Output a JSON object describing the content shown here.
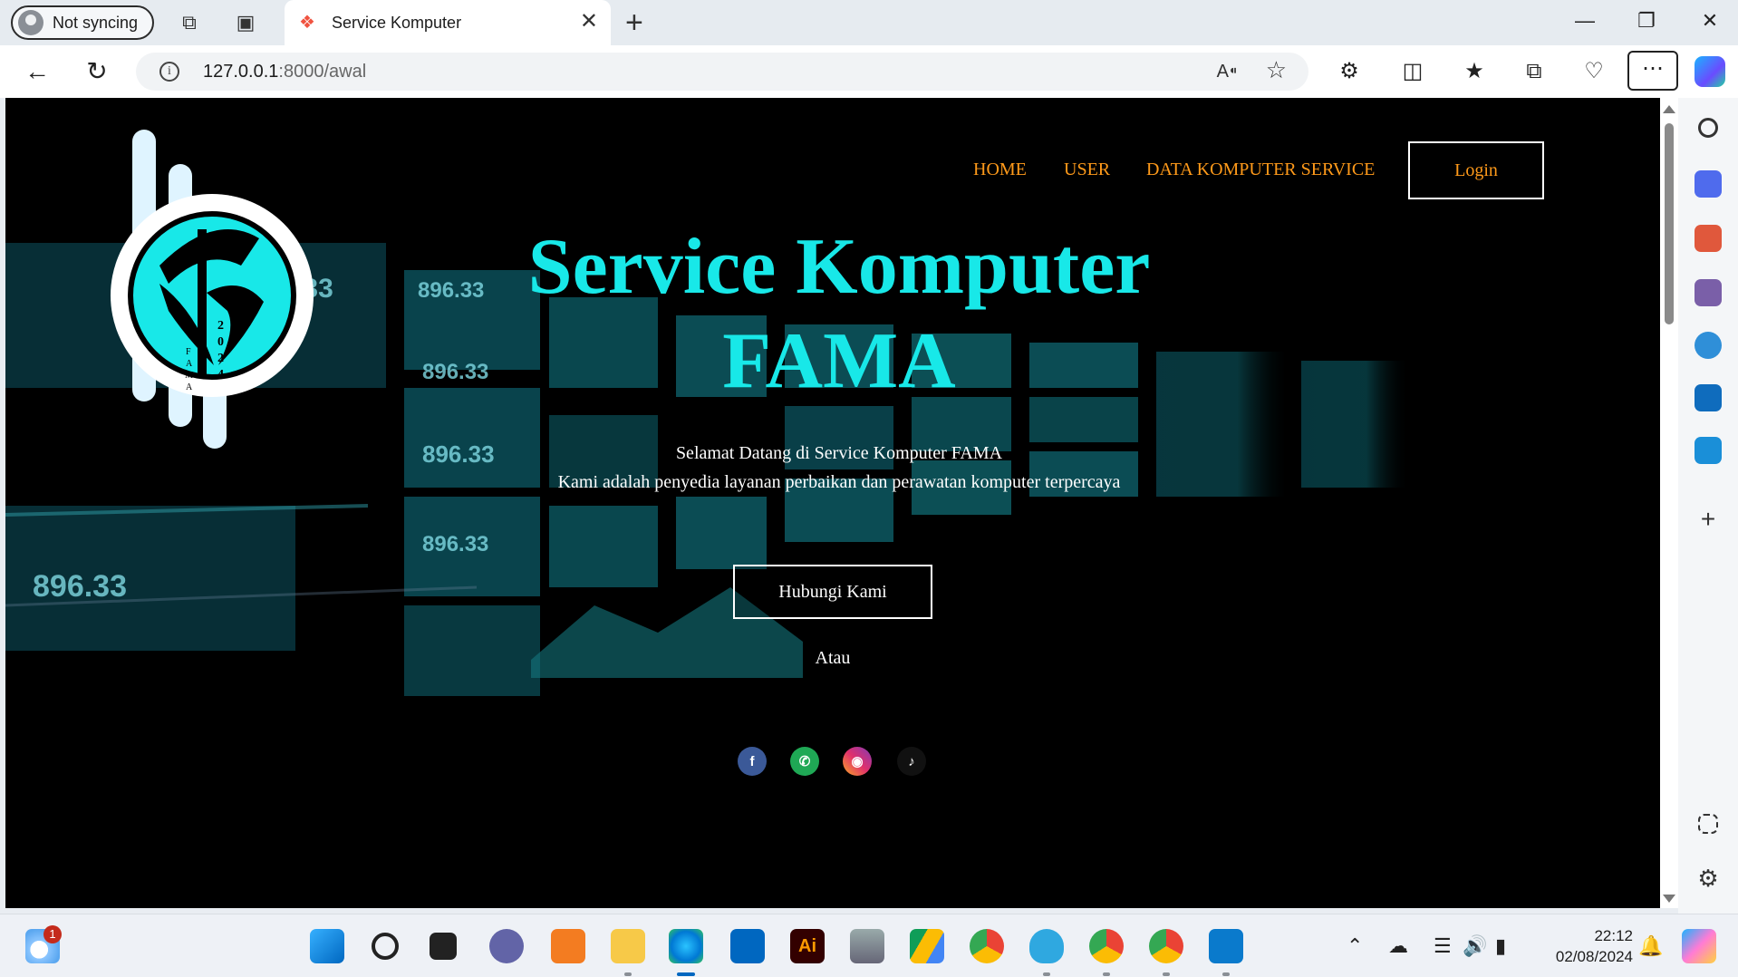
{
  "browser": {
    "profile_label": "Not syncing",
    "tab_title": "Service Komputer",
    "url_host": "127.0.0.1",
    "url_rest": ":8000/awal"
  },
  "site": {
    "nav": {
      "home": "HOME",
      "user": "USER",
      "data": "DATA KOMPUTER SERVICE",
      "login": "Login"
    },
    "logo_year": "2024",
    "logo_text": "FAMA",
    "hero_title_line1": "Service Komputer",
    "hero_title_line2": "FAMA",
    "welcome": "Selamat Datang di Service Komputer FAMA",
    "tagline": "Kami adalah penyedia layanan perbaikan dan perawatan komputer terpercaya",
    "contact_button": "Hubungi Kami",
    "or_text": "Atau",
    "social": [
      "facebook-icon",
      "whatsapp-icon",
      "instagram-icon",
      "tiktok-icon"
    ],
    "accent_color": "#18e8e8",
    "nav_color": "#ff9a1a",
    "panel_number": "896.33"
  },
  "taskbar": {
    "weather_badge": "1",
    "time": "22:12",
    "date": "02/08/2024"
  }
}
